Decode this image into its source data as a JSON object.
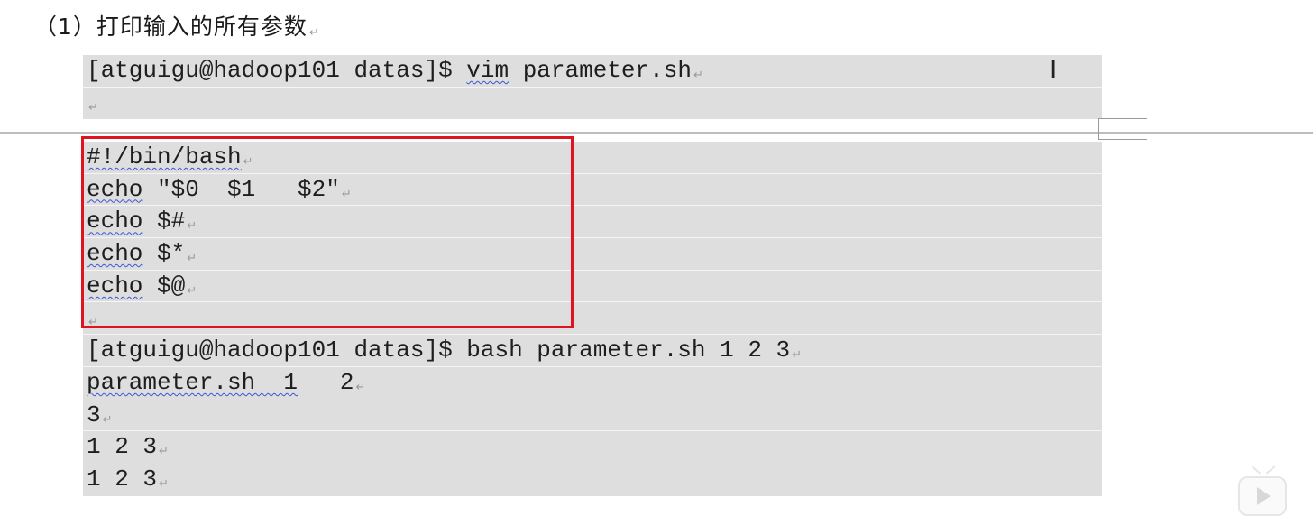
{
  "heading": "（1）打印输入的所有参数",
  "para_mark": "↵",
  "block1": {
    "line1": {
      "prompt": "[atguigu@hadoop101 datas]$ ",
      "cmd": "vim",
      "rest": " parameter.sh"
    },
    "line2": ""
  },
  "script": {
    "shebang": "#!/bin/bash",
    "lines": [
      {
        "cmd": "echo",
        "args": " \"$0  $1   $2\""
      },
      {
        "cmd": "echo",
        "args": " $#"
      },
      {
        "cmd": "echo",
        "args": " $*"
      },
      {
        "cmd": "echo",
        "args": " $@"
      }
    ]
  },
  "output": {
    "run": "[atguigu@hadoop101 datas]$ bash parameter.sh 1 2 3",
    "out1_name": "parameter.sh  1",
    "out1_rest": "   2",
    "out2": "3",
    "out3": "1 2 3",
    "out4": "1 2 3"
  },
  "cursor_glyph": "I",
  "colors": {
    "highlight_border": "#e0141e",
    "code_background": "#dedede",
    "spellcheck_underline": "#3b55d6"
  }
}
